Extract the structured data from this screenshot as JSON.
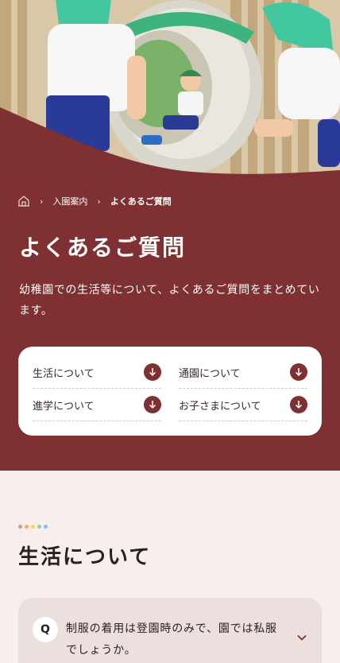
{
  "breadcrumb": {
    "home_icon": "home-icon",
    "items": [
      "入園案内",
      "よくあるご質問"
    ]
  },
  "page": {
    "title": "よくあるご質問",
    "description": "幼稚園での生活等について、よくあるご質問をまとめています。"
  },
  "categories": [
    {
      "label": "生活について",
      "icon": "arrow-down-icon"
    },
    {
      "label": "通園について",
      "icon": "arrow-down-icon"
    },
    {
      "label": "進学について",
      "icon": "arrow-down-icon"
    },
    {
      "label": "お子さまについて",
      "icon": "arrow-down-icon"
    }
  ],
  "section": {
    "title": "生活について",
    "dot_colors": [
      "#e98aa8",
      "#f0b24a",
      "#f3d75a",
      "#8fd0a2",
      "#7fc2e6"
    ]
  },
  "faq": [
    {
      "badge": "Q",
      "question": "制服の着用は登園時のみで、園では私服でしょうか。",
      "icon": "chevron-down-icon"
    }
  ],
  "colors": {
    "brand": "#7f3033",
    "background": "#f7efee",
    "faq_card": "#ece0de"
  }
}
